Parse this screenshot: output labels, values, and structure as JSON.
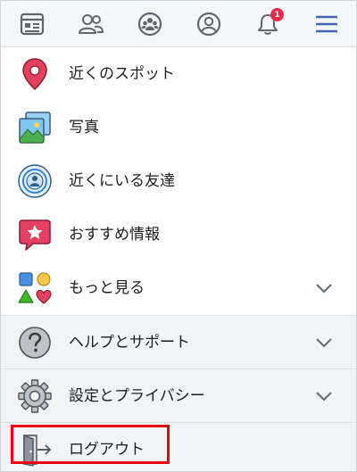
{
  "topbar": {
    "icons": [
      "news-feed-icon",
      "friends-icon",
      "groups-icon",
      "profile-icon",
      "notifications-icon",
      "menu-icon"
    ],
    "notification_count": "1",
    "accent": "#4267b2"
  },
  "menu": {
    "items": [
      {
        "label": "近くのスポット",
        "icon": "location-pin-icon"
      },
      {
        "label": "写真",
        "icon": "photos-icon"
      },
      {
        "label": "近くにいる友達",
        "icon": "nearby-friends-icon"
      },
      {
        "label": "おすすめ情報",
        "icon": "recommendations-icon"
      },
      {
        "label": "もっと見る",
        "icon": "more-shapes-icon"
      },
      {
        "label": "ヘルプとサポート",
        "icon": "help-icon"
      },
      {
        "label": "設定とプライバシー",
        "icon": "gear-icon"
      },
      {
        "label": "ログアウト",
        "icon": "logout-icon"
      }
    ]
  },
  "colors": {
    "highlight": "#e60012",
    "section_background": "#f2f3f5"
  }
}
